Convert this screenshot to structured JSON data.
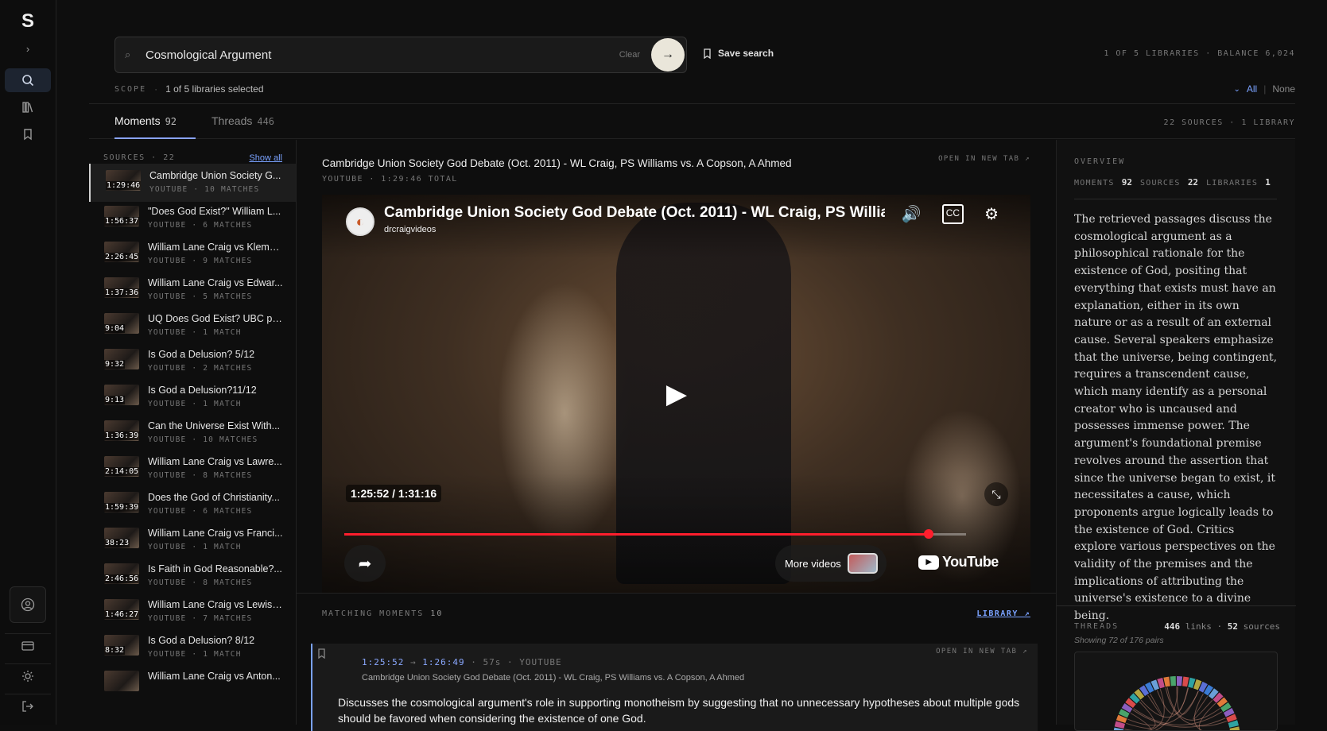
{
  "app": {
    "logo": "S"
  },
  "rail": {
    "items": [
      {
        "name": "toggle",
        "icon": "chevron-right-icon"
      },
      {
        "name": "search",
        "icon": "search-icon",
        "active": true
      },
      {
        "name": "library",
        "icon": "library-icon"
      },
      {
        "name": "bookmarks",
        "icon": "bookmark-icon"
      }
    ],
    "bottom": [
      {
        "name": "account",
        "icon": "user-circle-icon"
      },
      {
        "name": "billing",
        "icon": "card-icon"
      },
      {
        "name": "theme",
        "icon": "sun-icon"
      },
      {
        "name": "logout",
        "icon": "logout-icon"
      }
    ]
  },
  "search": {
    "value": "Cosmological Argument",
    "clear_label": "Clear",
    "save_label": "Save search",
    "meta": "1 OF 5 LIBRARIES · BALANCE 6,024"
  },
  "scope": {
    "label": "SCOPE",
    "value": "1 of 5 libraries selected",
    "all_label": "All",
    "none_label": "None"
  },
  "tabs": {
    "moments": {
      "label": "Moments",
      "count": "92"
    },
    "threads": {
      "label": "Threads",
      "count": "446"
    },
    "right_meta": "22 SOURCES · 1 LIBRARY"
  },
  "sources": {
    "header": "SOURCES · 22",
    "show_all": "Show all",
    "items": [
      {
        "title": "Cambridge Union Society G...",
        "meta": "YOUTUBE · 10 MATCHES",
        "dur": "1:29:46",
        "active": true
      },
      {
        "title": "\"Does God Exist?\" William L...",
        "meta": "YOUTUBE · 6 MATCHES",
        "dur": "1:56:37"
      },
      {
        "title": "William Lane Craig vs Kleme...",
        "meta": "YOUTUBE · 9 MATCHES",
        "dur": "2:26:45"
      },
      {
        "title": "William Lane Craig vs Edwar...",
        "meta": "YOUTUBE · 5 MATCHES",
        "dur": "1:37:36"
      },
      {
        "title": "UQ Does God Exist? UBC pt6.",
        "meta": "YOUTUBE · 1 MATCH",
        "dur": "9:04"
      },
      {
        "title": "Is God a Delusion? 5/12",
        "meta": "YOUTUBE · 2 MATCHES",
        "dur": "9:32"
      },
      {
        "title": "Is God a Delusion?11/12",
        "meta": "YOUTUBE · 1 MATCH",
        "dur": "9:13"
      },
      {
        "title": "Can the Universe Exist With...",
        "meta": "YOUTUBE · 10 MATCHES",
        "dur": "1:36:39"
      },
      {
        "title": "William Lane Craig vs Lawre...",
        "meta": "YOUTUBE · 8 MATCHES",
        "dur": "2:14:05"
      },
      {
        "title": "Does the God of Christianity...",
        "meta": "YOUTUBE · 6 MATCHES",
        "dur": "1:59:39"
      },
      {
        "title": "William Lane Craig vs Franci...",
        "meta": "YOUTUBE · 1 MATCH",
        "dur": "38:23"
      },
      {
        "title": "Is Faith in God Reasonable?...",
        "meta": "YOUTUBE · 8 MATCHES",
        "dur": "2:46:56"
      },
      {
        "title": "William Lane Craig vs Lewis ...",
        "meta": "YOUTUBE · 7 MATCHES",
        "dur": "1:46:27"
      },
      {
        "title": "Is God a Delusion? 8/12",
        "meta": "YOUTUBE · 1 MATCH",
        "dur": "8:32"
      },
      {
        "title": "William Lane Craig vs Anton...",
        "meta": "",
        "dur": ""
      }
    ]
  },
  "video": {
    "title": "Cambridge Union Society God Debate (Oct. 2011) - WL Craig, PS Williams vs. A Copson, A Ahmed",
    "subtitle": "YOUTUBE · 1:29:46 TOTAL",
    "open_new_tab": "OPEN IN NEW TAB ↗",
    "player": {
      "title": "Cambridge Union Society God Debate (Oct. 2011) - WL Craig, PS Williar",
      "channel": "drcraigvideos",
      "time": "1:25:52 / 1:31:16",
      "progress": 0.94,
      "more_videos": "More videos",
      "brand": "YouTube"
    }
  },
  "matching": {
    "label": "MATCHING MOMENTS",
    "count": "10",
    "dot": "·",
    "library_link": "LIBRARY ↗",
    "moment": {
      "start": "1:25:52",
      "end": "1:26:49",
      "duration": "57s",
      "platform": "YOUTUBE",
      "open_new_tab": "OPEN IN NEW TAB ↗",
      "source_title": "Cambridge Union Society God Debate (Oct. 2011) - WL Craig, PS Williams vs. A Copson, A Ahmed",
      "summary": "Discusses the cosmological argument's role in supporting monotheism by suggesting that no unnecessary hypotheses about multiple gods should be favored when considering the existence of one God."
    }
  },
  "overview": {
    "label": "OVERVIEW",
    "moments_label": "MOMENTS",
    "moments": "92",
    "sources_label": "SOURCES",
    "sources": "22",
    "libraries_label": "LIBRARIES",
    "libraries": "1",
    "text": "The retrieved passages discuss the cosmological argument as a philosophical rationale for the existence of God, positing that everything that exists must have an explanation, either in its own nature or as a result of an external cause. Several speakers emphasize that the universe, being contingent, requires a transcendent cause, which many identify as a personal creator who is uncaused and possesses immense power. The argument's foundational premise revolves around the assertion that since the universe began to exist, it necessitates a cause, which proponents argue logically leads to the existence of God. Critics explore various perspectives on the validity of the premises and the implications of attributing the universe's existence to a divine being.",
    "threads": {
      "label": "THREADS",
      "links": "446",
      "links_label": "links",
      "sources": "52",
      "sources_label": "sources",
      "showing": "Showing 72 of 176 pairs"
    }
  }
}
